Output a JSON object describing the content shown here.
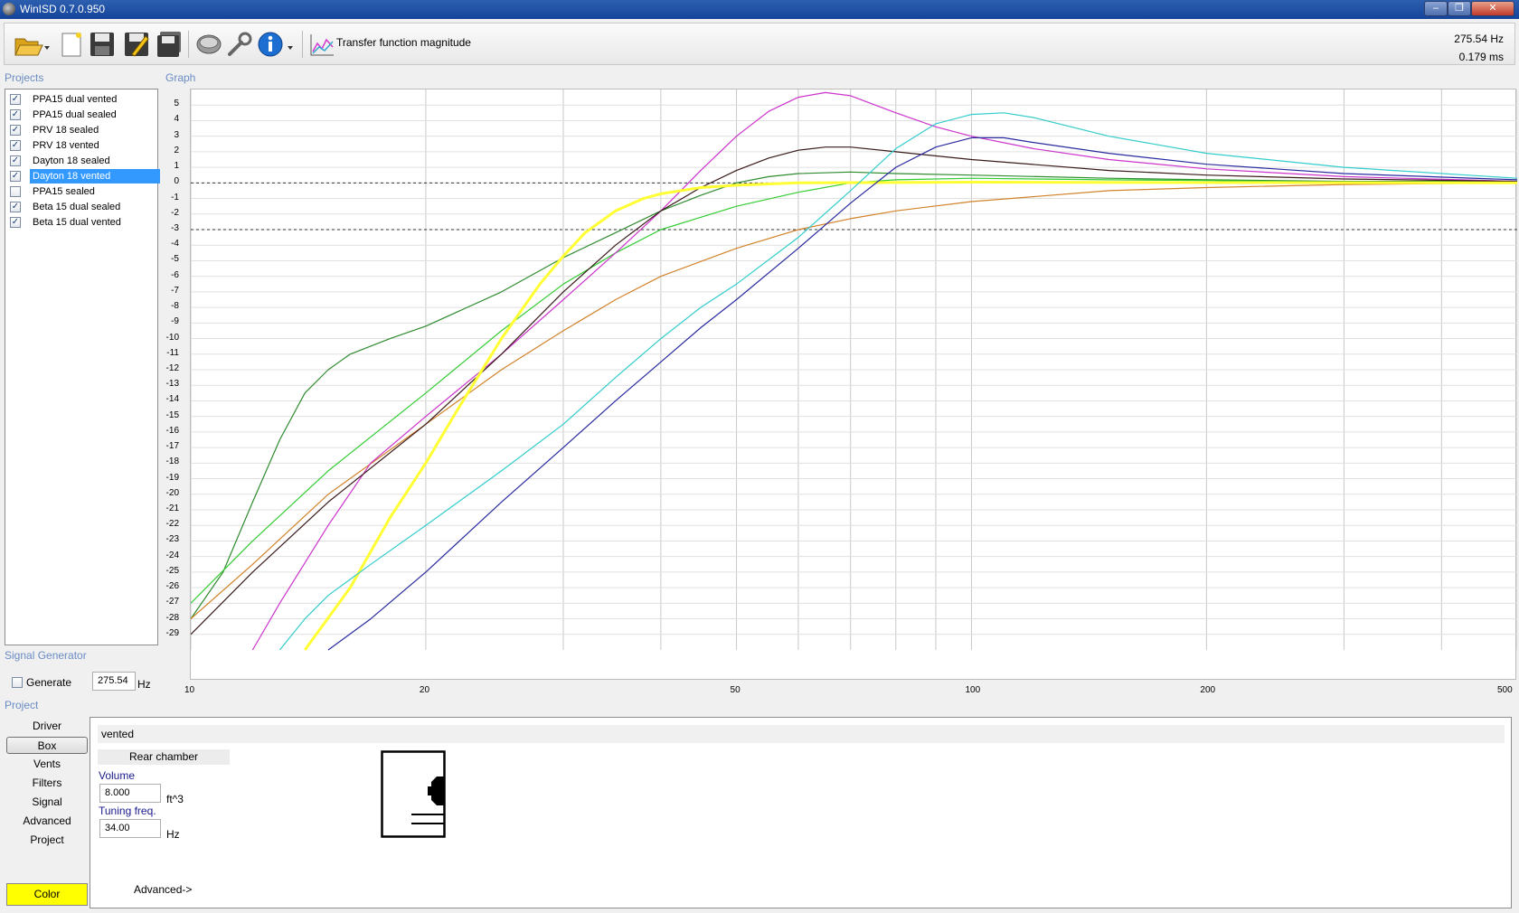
{
  "window": {
    "title": "WinISD 0.7.0.950"
  },
  "toolbar": {
    "graph_type_label": "Transfer function magnitude",
    "frequency": "275.54 Hz",
    "time": "0.179 ms",
    "icons": [
      "open-folder-icon",
      "new-document-icon",
      "save-icon",
      "save-as-icon",
      "save-all-icon",
      "driver-speaker-icon",
      "tools-wrench-icon",
      "info-icon",
      "graph-type-icon"
    ]
  },
  "projects": {
    "label": "Projects",
    "items": [
      {
        "name": "PPA15 dual vented",
        "checked": true,
        "color": "#808000"
      },
      {
        "name": "PPA15 dual sealed",
        "checked": true,
        "color": "#00c000"
      },
      {
        "name": "PRV 18 sealed",
        "checked": true,
        "color": "#d07020"
      },
      {
        "name": "PRV 18 vented",
        "checked": true,
        "color": "#cc00cc"
      },
      {
        "name": "Dayton 18 sealed",
        "checked": true,
        "color": "#3a1a1a"
      },
      {
        "name": "Dayton 18 vented",
        "checked": true,
        "selected": true,
        "color": "#ffff00"
      },
      {
        "name": "PPA15 sealed",
        "checked": false,
        "color": "#888888"
      },
      {
        "name": "Beta 15 dual sealed",
        "checked": true,
        "color": "#00cccc"
      },
      {
        "name": "Beta 15 dual vented",
        "checked": true,
        "color": "#1a1aa0"
      }
    ]
  },
  "graph": {
    "label": "Graph",
    "y_ticks": [
      "5",
      "4",
      "3",
      "2",
      "1",
      "0",
      "-1",
      "-2",
      "-3",
      "-4",
      "-5",
      "-6",
      "-7",
      "-8",
      "-9",
      "-10",
      "-11",
      "-12",
      "-13",
      "-14",
      "-15",
      "-16",
      "-17",
      "-18",
      "-19",
      "-20",
      "-21",
      "-22",
      "-23",
      "-24",
      "-25",
      "-26",
      "-27",
      "-28",
      "-29"
    ],
    "x_ticks": [
      "10",
      "20",
      "50",
      "100",
      "200",
      "500"
    ]
  },
  "chart_data": {
    "type": "line",
    "xscale": "log",
    "xlim": [
      10,
      500
    ],
    "ylim": [
      -30,
      6
    ],
    "x_ticks": [
      10,
      20,
      50,
      100,
      200,
      500
    ],
    "reference_lines": [
      0,
      -3
    ],
    "series": [
      {
        "name": "PPA15 dual vented",
        "color": "#2e8b2e",
        "points": [
          [
            10,
            -28
          ],
          [
            11,
            -25
          ],
          [
            12,
            -20.5
          ],
          [
            13,
            -16.5
          ],
          [
            14,
            -13.5
          ],
          [
            15,
            -12
          ],
          [
            16,
            -11
          ],
          [
            18,
            -10
          ],
          [
            20,
            -9.2
          ],
          [
            25,
            -7
          ],
          [
            30,
            -4.8
          ],
          [
            35,
            -3.2
          ],
          [
            40,
            -1.8
          ],
          [
            45,
            -0.8
          ],
          [
            50,
            0
          ],
          [
            55,
            0.4
          ],
          [
            60,
            0.6
          ],
          [
            70,
            0.7
          ],
          [
            80,
            0.6
          ],
          [
            100,
            0.5
          ],
          [
            150,
            0.3
          ],
          [
            200,
            0.2
          ],
          [
            300,
            0.1
          ],
          [
            500,
            0.1
          ]
        ]
      },
      {
        "name": "PPA15 dual sealed",
        "color": "#33cc33",
        "points": [
          [
            10,
            -27
          ],
          [
            12,
            -23
          ],
          [
            15,
            -18.5
          ],
          [
            20,
            -13.5
          ],
          [
            25,
            -9.5
          ],
          [
            30,
            -6.5
          ],
          [
            35,
            -4.5
          ],
          [
            40,
            -3
          ],
          [
            50,
            -1.5
          ],
          [
            60,
            -0.6
          ],
          [
            70,
            0
          ],
          [
            80,
            0.2
          ],
          [
            100,
            0.3
          ],
          [
            150,
            0.2
          ],
          [
            200,
            0.15
          ],
          [
            300,
            0.05
          ],
          [
            500,
            0
          ]
        ]
      },
      {
        "name": "PRV 18 sealed",
        "color": "#d2822a",
        "points": [
          [
            10,
            -28
          ],
          [
            12,
            -24.5
          ],
          [
            15,
            -20
          ],
          [
            20,
            -15.5
          ],
          [
            25,
            -12
          ],
          [
            30,
            -9.5
          ],
          [
            35,
            -7.5
          ],
          [
            40,
            -6
          ],
          [
            50,
            -4.2
          ],
          [
            60,
            -3
          ],
          [
            70,
            -2.3
          ],
          [
            80,
            -1.8
          ],
          [
            100,
            -1.2
          ],
          [
            150,
            -0.5
          ],
          [
            200,
            -0.3
          ],
          [
            300,
            -0.1
          ],
          [
            500,
            0
          ]
        ]
      },
      {
        "name": "PRV 18 vented",
        "color": "#cc33cc",
        "points": [
          [
            12,
            -30
          ],
          [
            13,
            -27
          ],
          [
            15,
            -22
          ],
          [
            17,
            -18
          ],
          [
            20,
            -15
          ],
          [
            25,
            -11
          ],
          [
            30,
            -7.5
          ],
          [
            35,
            -4.5
          ],
          [
            40,
            -1.8
          ],
          [
            45,
            0.8
          ],
          [
            50,
            3
          ],
          [
            55,
            4.6
          ],
          [
            60,
            5.5
          ],
          [
            65,
            5.8
          ],
          [
            70,
            5.6
          ],
          [
            80,
            4.5
          ],
          [
            90,
            3.6
          ],
          [
            100,
            3
          ],
          [
            120,
            2.2
          ],
          [
            150,
            1.5
          ],
          [
            200,
            0.9
          ],
          [
            300,
            0.4
          ],
          [
            500,
            0.1
          ]
        ]
      },
      {
        "name": "Dayton 18 sealed",
        "color": "#3a1a1a",
        "points": [
          [
            10,
            -29
          ],
          [
            12,
            -25
          ],
          [
            15,
            -20.5
          ],
          [
            20,
            -15.5
          ],
          [
            25,
            -11
          ],
          [
            30,
            -7
          ],
          [
            35,
            -4
          ],
          [
            40,
            -1.8
          ],
          [
            45,
            -0.3
          ],
          [
            50,
            0.8
          ],
          [
            55,
            1.6
          ],
          [
            60,
            2.1
          ],
          [
            65,
            2.3
          ],
          [
            70,
            2.3
          ],
          [
            80,
            2
          ],
          [
            100,
            1.5
          ],
          [
            150,
            0.8
          ],
          [
            200,
            0.5
          ],
          [
            300,
            0.25
          ],
          [
            500,
            0.1
          ]
        ]
      },
      {
        "name": "Dayton 18 vented",
        "color": "#ffff33",
        "points": [
          [
            14,
            -30
          ],
          [
            16,
            -26
          ],
          [
            18,
            -21.5
          ],
          [
            20,
            -18
          ],
          [
            22,
            -14.5
          ],
          [
            25,
            -10
          ],
          [
            28,
            -6.5
          ],
          [
            30,
            -4.7
          ],
          [
            32,
            -3.2
          ],
          [
            35,
            -1.8
          ],
          [
            38,
            -1
          ],
          [
            40,
            -0.7
          ],
          [
            45,
            -0.3
          ],
          [
            50,
            -0.15
          ],
          [
            60,
            0
          ],
          [
            100,
            0.05
          ],
          [
            200,
            0.02
          ],
          [
            500,
            0
          ]
        ]
      },
      {
        "name": "Beta 15 dual sealed",
        "color": "#33cccc",
        "points": [
          [
            13,
            -30
          ],
          [
            14,
            -28
          ],
          [
            15,
            -26.5
          ],
          [
            17,
            -24.5
          ],
          [
            20,
            -22
          ],
          [
            25,
            -18.5
          ],
          [
            30,
            -15.5
          ],
          [
            35,
            -12.5
          ],
          [
            40,
            -10
          ],
          [
            45,
            -8
          ],
          [
            50,
            -6.5
          ],
          [
            60,
            -3.5
          ],
          [
            70,
            -0.5
          ],
          [
            80,
            2.2
          ],
          [
            90,
            3.8
          ],
          [
            100,
            4.4
          ],
          [
            110,
            4.5
          ],
          [
            120,
            4.2
          ],
          [
            150,
            3
          ],
          [
            200,
            1.9
          ],
          [
            300,
            1
          ],
          [
            500,
            0.3
          ]
        ]
      },
      {
        "name": "Beta 15 dual vented",
        "color": "#2a2aa0",
        "points": [
          [
            15,
            -30
          ],
          [
            17,
            -28
          ],
          [
            20,
            -25
          ],
          [
            25,
            -20.5
          ],
          [
            30,
            -17
          ],
          [
            35,
            -14
          ],
          [
            40,
            -11.5
          ],
          [
            45,
            -9.3
          ],
          [
            50,
            -7.5
          ],
          [
            60,
            -4.2
          ],
          [
            70,
            -1.3
          ],
          [
            80,
            1
          ],
          [
            90,
            2.3
          ],
          [
            100,
            2.9
          ],
          [
            110,
            2.9
          ],
          [
            120,
            2.6
          ],
          [
            150,
            1.9
          ],
          [
            200,
            1.2
          ],
          [
            300,
            0.6
          ],
          [
            500,
            0.2
          ]
        ]
      }
    ]
  },
  "signal_generator": {
    "label": "Signal Generator",
    "generate_label": "Generate",
    "frequency_value": "275.54",
    "unit": "Hz"
  },
  "project_section": {
    "label": "Project",
    "nav": [
      "Driver",
      "Box",
      "Vents",
      "Filters",
      "Signal",
      "Advanced",
      "Project"
    ],
    "active_nav": "Box",
    "color_button": "Color",
    "color_value": "#ffff00"
  },
  "box_panel": {
    "box_type": "vented",
    "chamber_label": "Rear chamber",
    "volume_label": "Volume",
    "volume_value": "8.000",
    "volume_unit": "ft^3",
    "tuning_label": "Tuning freq.",
    "tuning_value": "34.00",
    "tuning_unit": "Hz",
    "advanced_link": "Advanced->"
  }
}
